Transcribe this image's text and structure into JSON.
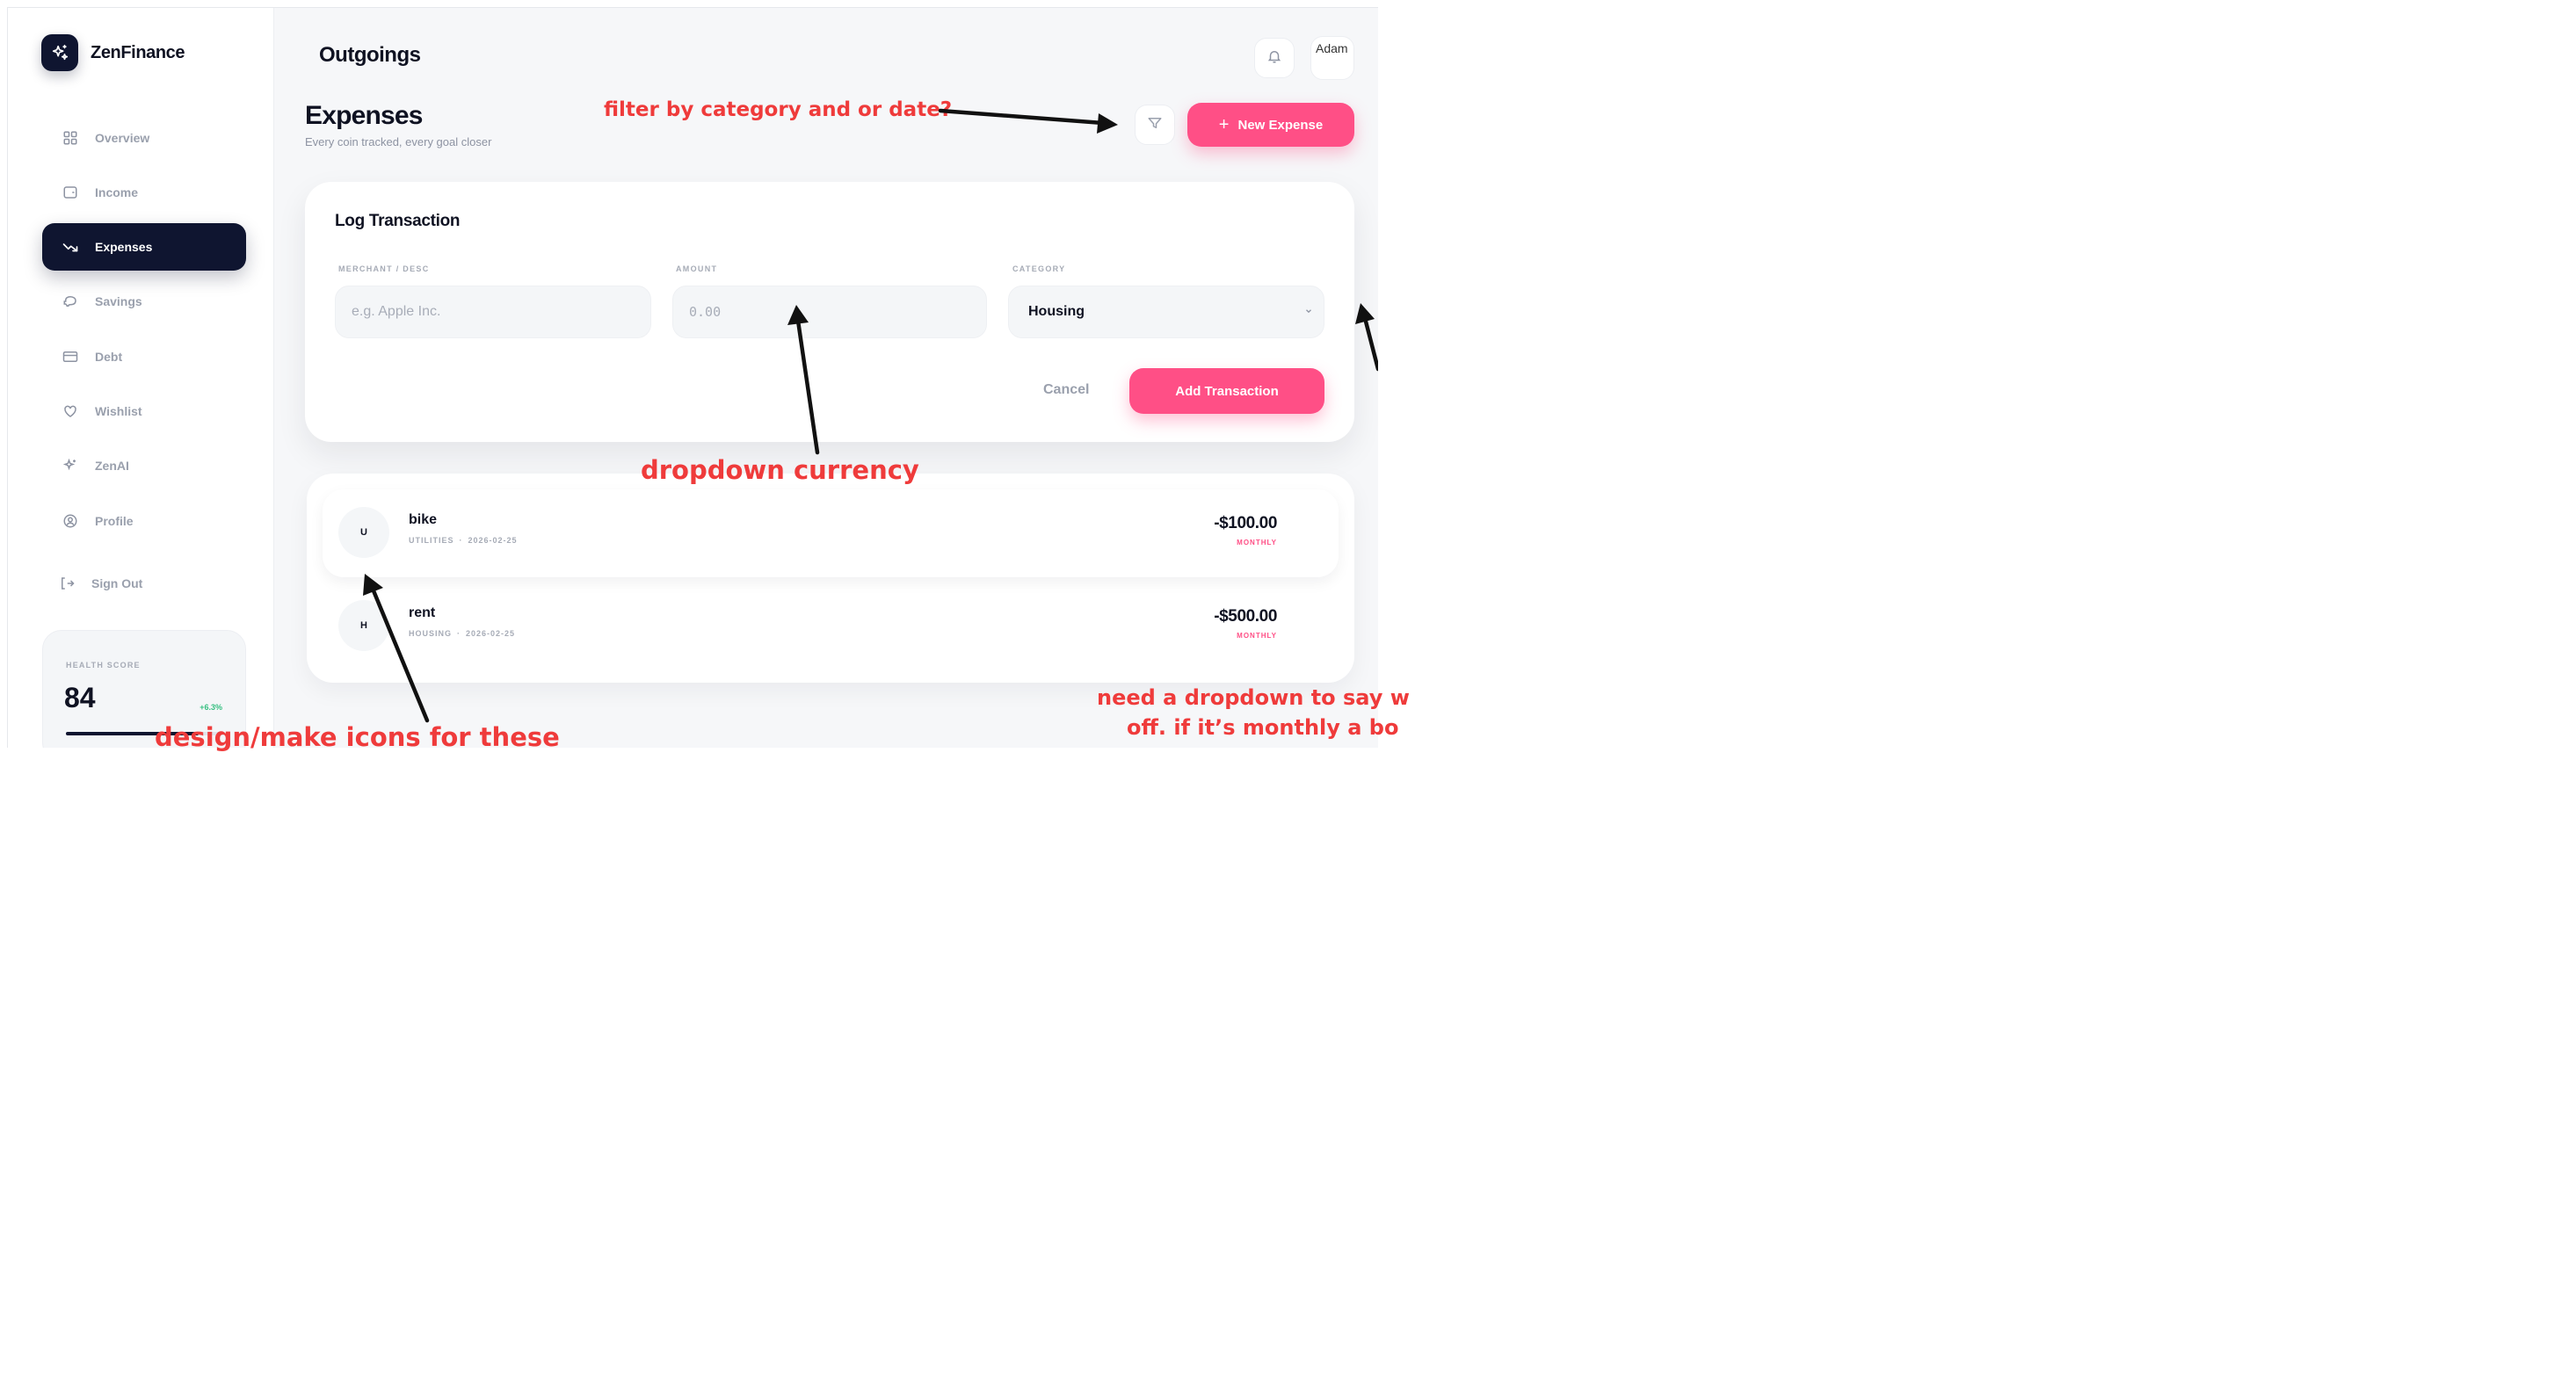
{
  "brand": {
    "name": "ZenFinance",
    "logo_icon": "sparkles-icon"
  },
  "sidebar": {
    "items": [
      {
        "label": "Overview",
        "icon": "grid-icon",
        "active": false
      },
      {
        "label": "Income",
        "icon": "wallet-icon",
        "active": false
      },
      {
        "label": "Expenses",
        "icon": "trending-down-icon",
        "active": true
      },
      {
        "label": "Savings",
        "icon": "piggy-bank-icon",
        "active": false
      },
      {
        "label": "Debt",
        "icon": "credit-card-icon",
        "active": false
      },
      {
        "label": "Wishlist",
        "icon": "heart-icon",
        "active": false
      },
      {
        "label": "ZenAI",
        "icon": "sparkles-icon",
        "active": false
      },
      {
        "label": "Profile",
        "icon": "user-circle-icon",
        "active": false
      },
      {
        "label": "Sign Out",
        "icon": "log-out-icon",
        "active": false
      }
    ],
    "health": {
      "title": "HEALTH SCORE",
      "score": "84",
      "delta": "+6.3%",
      "progress": 0.84
    }
  },
  "header": {
    "title": "Outgoings",
    "bell_icon": "bell-icon",
    "avatar_alt": "Adam"
  },
  "page": {
    "title": "Expenses",
    "subtitle": "Every coin tracked, every goal closer",
    "filter_icon": "filter-icon",
    "new_button": {
      "plus": "+",
      "label": "New Expense"
    }
  },
  "form": {
    "title": "Log Transaction",
    "merchant": {
      "label": "MERCHANT / DESC",
      "placeholder": "e.g. Apple Inc.",
      "value": ""
    },
    "amount": {
      "label": "AMOUNT",
      "placeholder": "0.00",
      "value": ""
    },
    "category": {
      "label": "CATEGORY",
      "value": "Housing"
    },
    "cancel_label": "Cancel",
    "submit_label": "Add Transaction"
  },
  "transactions": [
    {
      "initial": "U",
      "name": "bike",
      "category": "UTILITIES",
      "date": "2026-02-25",
      "amount": "-$100.00",
      "frequency": "MONTHLY"
    },
    {
      "initial": "H",
      "name": "rent",
      "category": "HOUSING",
      "date": "2026-02-25",
      "amount": "-$500.00",
      "frequency": "MONTHLY"
    }
  ],
  "annotations": {
    "filter": "filter by category and or date?",
    "currency": "dropdown currency",
    "icons": "design/make icons for these",
    "dropdown_line1": "need a dropdown to say w",
    "dropdown_line2": "off. if it’s monthly a bo"
  },
  "colors": {
    "accent": "#ff4f86",
    "dark": "#0f1530",
    "annotation": "#ef3b3b",
    "positive": "#38c082"
  }
}
